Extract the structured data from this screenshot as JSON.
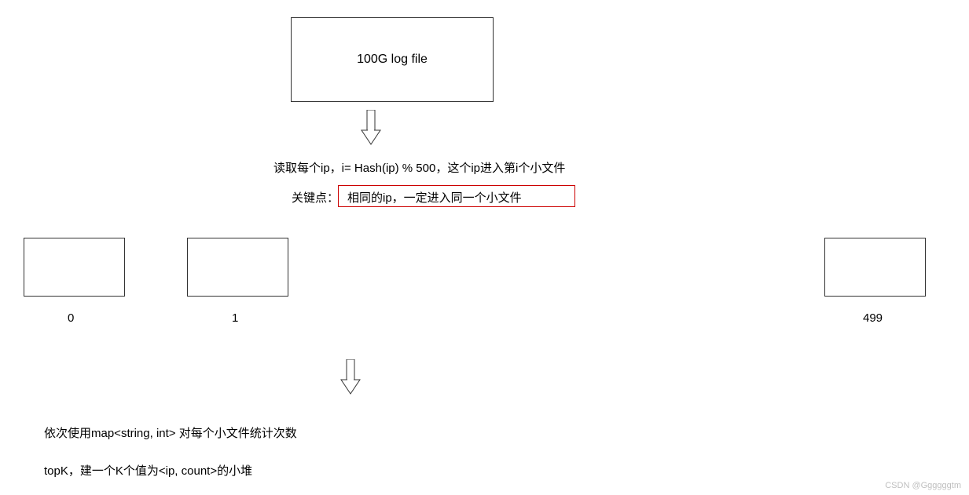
{
  "top_box_label": "100G log file",
  "line1": "读取每个ip，i= Hash(ip) % 500，这个ip进入第i个小文件",
  "line2_prefix": "关键点：",
  "line2_highlight": "相同的ip，一定进入同一个小文件",
  "files": {
    "first": "0",
    "second": "1",
    "last": "499"
  },
  "bottom_line1": "依次使用map<string, int> 对每个小文件统计次数",
  "bottom_line2": "topK，建一个K个值为<ip, count>的小堆",
  "watermark": "CSDN @Ggggggtm"
}
